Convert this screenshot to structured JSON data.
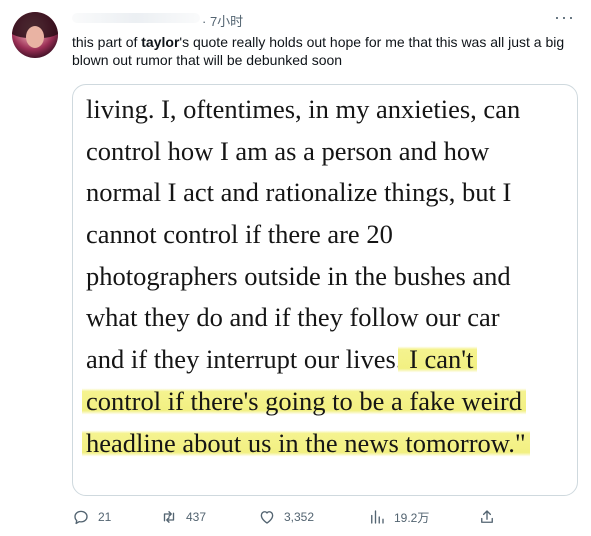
{
  "tweet": {
    "timestamp": "· 7小时",
    "text_before": "this part of ",
    "text_bold": "taylor",
    "text_after": "'s quote really holds out hope for me that this was all just a big blown out rumor that will be debunked soon"
  },
  "quote_image": {
    "lines": [
      {
        "normal": "living. I, oftentimes, in my anxieties, can",
        "highlight": ""
      },
      {
        "normal": "control how I am as a person and how",
        "highlight": ""
      },
      {
        "normal": "normal I act and rationalize things, but I",
        "highlight": ""
      },
      {
        "normal": "cannot control if there are 20",
        "highlight": ""
      },
      {
        "normal": "photographers outside in the bushes and",
        "highlight": ""
      },
      {
        "normal": "what they do and if they follow our car",
        "highlight": ""
      },
      {
        "normal": "and if they interrupt our lives.",
        "highlight": " I can't"
      },
      {
        "normal": "",
        "highlight": "control if there's going to be a fake weird"
      },
      {
        "normal": "",
        "highlight": "headline about us in the news tomorrow.\""
      }
    ],
    "highlight_color": "#f2f082"
  },
  "actions": {
    "reply_count": "21",
    "retweet_count": "437",
    "like_count": "3,352",
    "views_count": "19.2万"
  }
}
